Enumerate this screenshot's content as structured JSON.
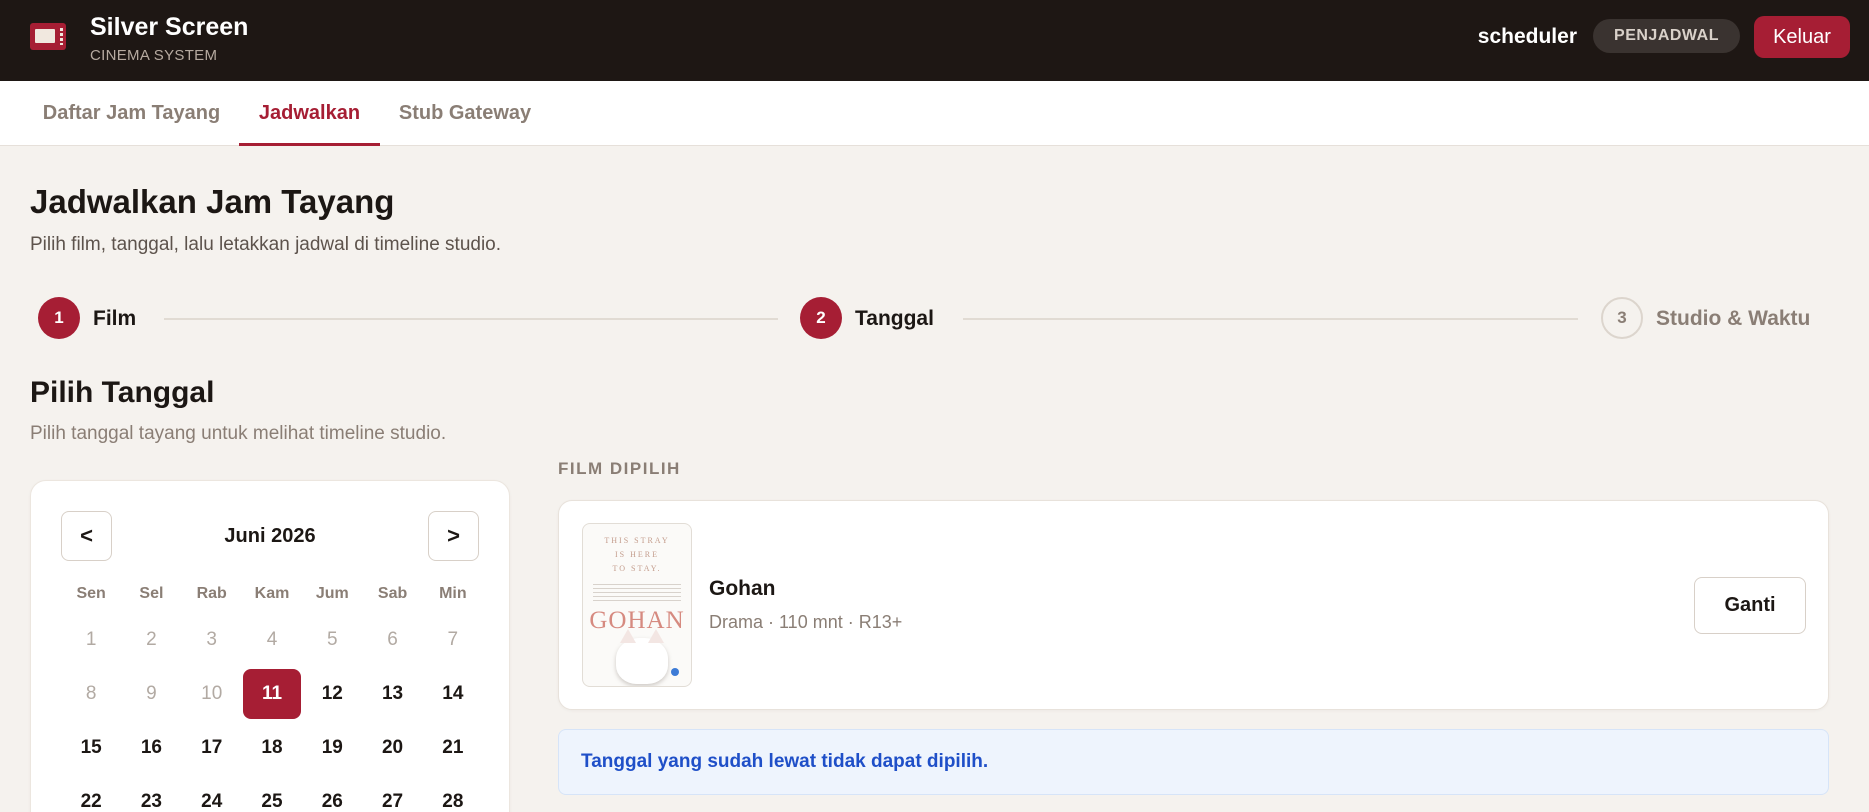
{
  "header": {
    "app_title": "Silver Screen",
    "app_subtitle": "CINEMA SYSTEM",
    "username": "scheduler",
    "role_badge": "PENJADWAL",
    "logout_label": "Keluar",
    "logo_icon": "ticket-icon"
  },
  "tabs": [
    {
      "label": "Daftar Jam Tayang",
      "active": false
    },
    {
      "label": "Jadwalkan",
      "active": true
    },
    {
      "label": "Stub Gateway",
      "active": false
    }
  ],
  "page": {
    "title": "Jadwalkan Jam Tayang",
    "subtitle": "Pilih film, tanggal, lalu letakkan jadwal di timeline studio."
  },
  "stepper": [
    {
      "number": "1",
      "label": "Film",
      "state": "done"
    },
    {
      "number": "2",
      "label": "Tanggal",
      "state": "done"
    },
    {
      "number": "3",
      "label": "Studio & Waktu",
      "state": "pending"
    }
  ],
  "date_section": {
    "title": "Pilih Tanggal",
    "subtitle": "Pilih tanggal tayang untuk melihat timeline studio."
  },
  "calendar": {
    "prev_label": "<",
    "next_label": ">",
    "month_label": "Juni 2026",
    "weekdays": [
      "Sen",
      "Sel",
      "Rab",
      "Kam",
      "Jum",
      "Sab",
      "Min"
    ],
    "weeks": [
      [
        "1",
        "2",
        "3",
        "4",
        "5",
        "6",
        "7"
      ],
      [
        "8",
        "9",
        "10",
        "11",
        "12",
        "13",
        "14"
      ],
      [
        "15",
        "16",
        "17",
        "18",
        "19",
        "20",
        "21"
      ],
      [
        "22",
        "23",
        "24",
        "25",
        "26",
        "27",
        "28"
      ]
    ],
    "past_days": [
      "1",
      "2",
      "3",
      "4",
      "5",
      "6",
      "7",
      "8",
      "9",
      "10"
    ],
    "selected_day": "11"
  },
  "selected_film": {
    "section_label": "FILM DIPILIH",
    "title": "Gohan",
    "meta": "Drama · 110 mnt · R13+",
    "poster_tagline": "THIS STRAY\nIS HERE\nTO STAY.",
    "poster_title": "GOHAN",
    "change_label": "Ganti"
  },
  "info_alert": {
    "text": "Tanggal yang sudah lewat tidak dapat dipilih."
  },
  "colors": {
    "accent": "#a61e34",
    "header_bg": "#1e1714",
    "page_bg": "#f5f2ee",
    "info_text": "#1f4fc8",
    "info_bg": "#eef4fd"
  }
}
